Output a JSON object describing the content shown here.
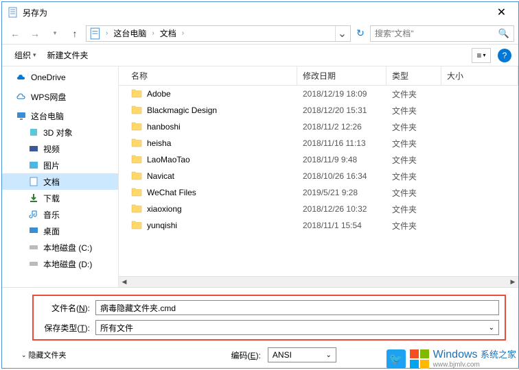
{
  "title": "另存为",
  "breadcrumb": {
    "root": "这台电脑",
    "current": "文档"
  },
  "search": {
    "placeholder": "搜索\"文档\""
  },
  "toolbar": {
    "organize": "组织",
    "new_folder": "新建文件夹"
  },
  "sidebar": {
    "onedrive": "OneDrive",
    "wps": "WPS网盘",
    "thispc": "这台电脑",
    "children": [
      {
        "label": "3D 对象"
      },
      {
        "label": "视频"
      },
      {
        "label": "图片"
      },
      {
        "label": "文档"
      },
      {
        "label": "下载"
      },
      {
        "label": "音乐"
      },
      {
        "label": "桌面"
      },
      {
        "label": "本地磁盘 (C:)"
      },
      {
        "label": "本地磁盘 (D:)"
      }
    ]
  },
  "columns": {
    "name": "名称",
    "date": "修改日期",
    "type": "类型",
    "size": "大小"
  },
  "files": [
    {
      "name": "Adobe",
      "date": "2018/12/19 18:09",
      "type": "文件夹"
    },
    {
      "name": "Blackmagic Design",
      "date": "2018/12/20 15:31",
      "type": "文件夹"
    },
    {
      "name": "hanboshi",
      "date": "2018/11/2 12:26",
      "type": "文件夹"
    },
    {
      "name": "heisha",
      "date": "2018/11/16 11:13",
      "type": "文件夹"
    },
    {
      "name": "LaoMaoTao",
      "date": "2018/11/9 9:48",
      "type": "文件夹"
    },
    {
      "name": "Navicat",
      "date": "2018/10/26 16:34",
      "type": "文件夹"
    },
    {
      "name": "WeChat Files",
      "date": "2019/5/21 9:28",
      "type": "文件夹"
    },
    {
      "name": "xiaoxiong",
      "date": "2018/12/26 10:32",
      "type": "文件夹"
    },
    {
      "name": "yunqishi",
      "date": "2018/11/1 15:54",
      "type": "文件夹"
    }
  ],
  "filename": {
    "label_pre": "文件名(",
    "label_key": "N",
    "label_post": "):",
    "value": "病毒隐藏文件夹.cmd"
  },
  "filetype": {
    "label_pre": "保存类型(",
    "label_key": "T",
    "label_post": "):",
    "value": "所有文件"
  },
  "footer": {
    "hide_folders": "隐藏文件夹",
    "encoding_label_pre": "编码(",
    "encoding_label_key": "E",
    "encoding_label_post": "):",
    "encoding_value": "ANSI"
  },
  "watermark": {
    "brand": "Windows",
    "sub": "系统之家",
    "url": "www.bjmlv.com"
  }
}
